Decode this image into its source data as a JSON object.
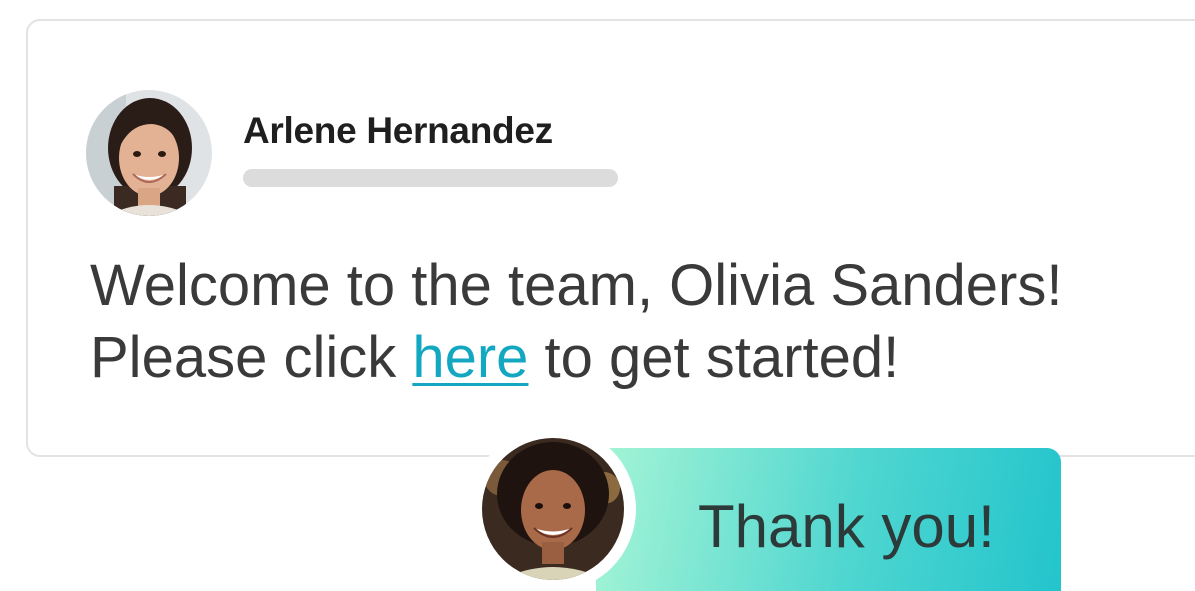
{
  "card": {
    "sender_name": "Arlene Hernandez",
    "message_line1": "Welcome to the team, Olivia Sanders!",
    "message_line2_before": "Please click ",
    "message_link": "here",
    "message_line2_after": " to get started!"
  },
  "reply": {
    "text": "Thank you!"
  },
  "icons": {
    "sender_avatar": "user-avatar-photo",
    "reply_avatar": "user-avatar-photo"
  },
  "colors": {
    "link": "#13a7c2",
    "bubble_start": "#a6f5d5",
    "bubble_end": "#22c4cc",
    "placeholder_bar": "#dcdcdc"
  }
}
